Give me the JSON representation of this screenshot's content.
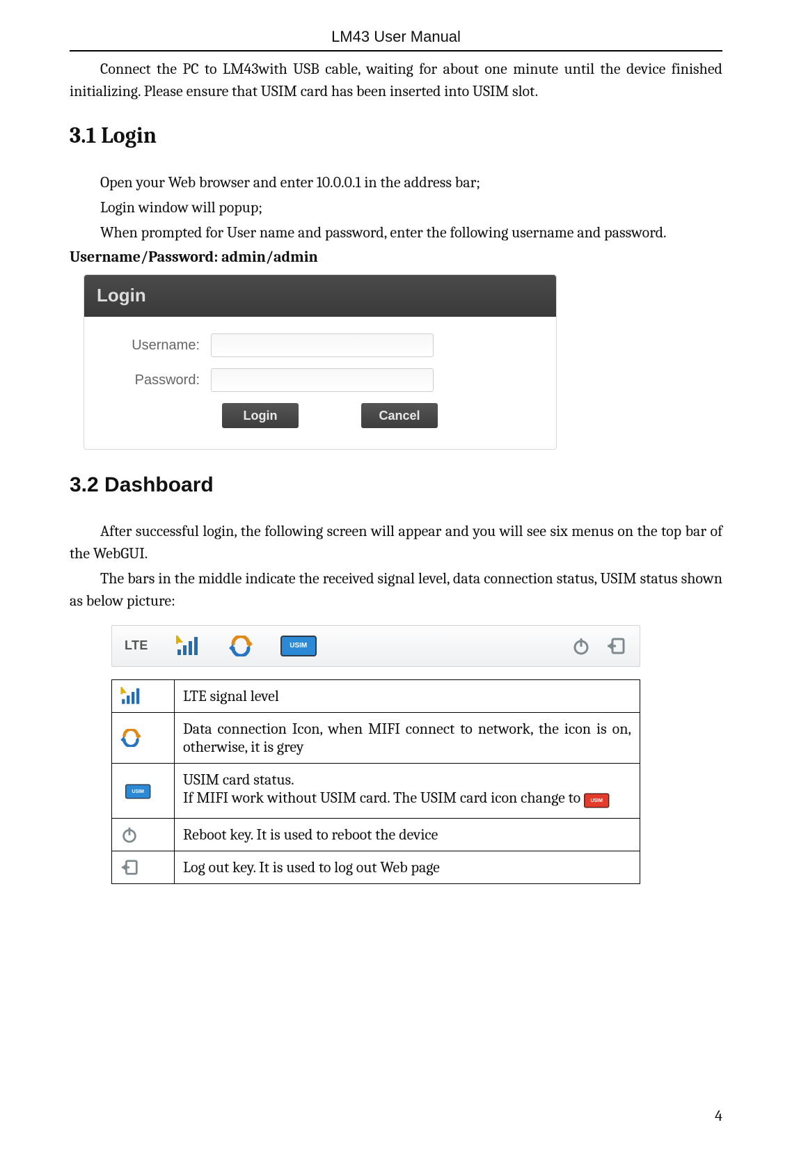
{
  "header": {
    "title": "LM43 User Manual"
  },
  "intro": {
    "p1": "Connect the PC to LM43with USB cable, waiting for about one minute until the device finished initializing. Please ensure that USIM card has been inserted into USIM slot."
  },
  "section31": {
    "heading": "3.1 Login",
    "p1": "Open your Web browser and enter 10.0.0.1 in the address bar;",
    "p2": "Login window will popup;",
    "p3": "When prompted for User name and password, enter the following username and password.",
    "credentials": "Username/Password: admin/admin"
  },
  "login": {
    "title": "Login",
    "username_label": "Username:",
    "password_label": "Password:",
    "username_value": "",
    "password_value": "",
    "login_btn": "Login",
    "cancel_btn": "Cancel"
  },
  "section32": {
    "heading": "3.2 Dashboard",
    "p1": "After successful login, the following screen will appear and you will see six menus on the top bar of the WebGUI.",
    "p2": "The bars in the middle indicate the received signal level, data connection status, USIM status shown as below picture:"
  },
  "statusbar": {
    "network_label": "LTE",
    "icons": {
      "signal": "signal-bars-icon",
      "connection": "connection-arrows-icon",
      "usim": "usim-card-icon",
      "reboot": "reboot-icon",
      "logout": "logout-icon"
    },
    "usim_text": "USIM"
  },
  "legend": {
    "rows": [
      {
        "icon": "signal-bars-icon",
        "desc": "LTE signal level"
      },
      {
        "icon": "connection-arrows-icon",
        "desc": "Data connection Icon, when MIFI connect to network, the icon is on, otherwise, it is grey"
      },
      {
        "icon": "usim-card-icon",
        "desc_line1": "USIM card status.",
        "desc_line2": "If MIFI work without USIM card. The USIM card icon change to "
      },
      {
        "icon": "reboot-icon",
        "desc": "Reboot key. It is used to reboot the device"
      },
      {
        "icon": "logout-icon",
        "desc": "Log out key. It is used to log out Web page"
      }
    ]
  },
  "page": {
    "number": "4"
  }
}
